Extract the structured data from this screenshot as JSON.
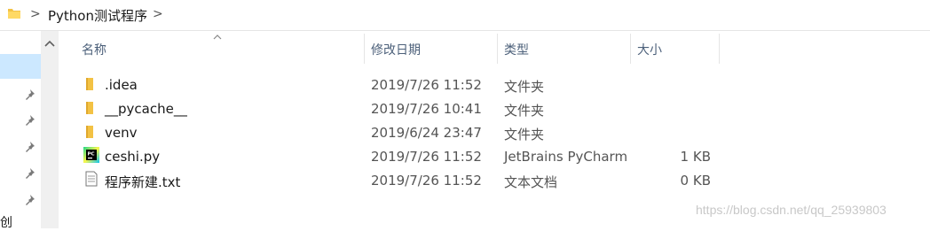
{
  "address_bar": {
    "folder_icon": "folder-icon",
    "chevron": ">",
    "path_segment": "Python测试程序",
    "dropdown_chevron": ">"
  },
  "nav_pane": {
    "partial_label": "创"
  },
  "columns": {
    "name": "名称",
    "modified": "修改日期",
    "type": "类型",
    "size": "大小"
  },
  "files": [
    {
      "name": ".idea",
      "modified": "2019/7/26 11:52",
      "type": "文件夹",
      "size": "",
      "icon": "folder-icon"
    },
    {
      "name": "__pycache__",
      "modified": "2019/7/26 10:41",
      "type": "文件夹",
      "size": "",
      "icon": "folder-icon"
    },
    {
      "name": "venv",
      "modified": "2019/6/24 23:47",
      "type": "文件夹",
      "size": "",
      "icon": "folder-icon"
    },
    {
      "name": "ceshi.py",
      "modified": "2019/7/26 11:52",
      "type": "JetBrains PyCharm",
      "size": "1 KB",
      "icon": "pycharm-file-icon"
    },
    {
      "name": "程序新建.txt",
      "modified": "2019/7/26 11:52",
      "type": "文本文档",
      "size": "0 KB",
      "icon": "text-file-icon"
    }
  ],
  "watermark": "https://blog.csdn.net/qq_25939803",
  "colors": {
    "folder": "#f3c244",
    "selection": "#cce8ff",
    "header_text": "#4c607a"
  }
}
